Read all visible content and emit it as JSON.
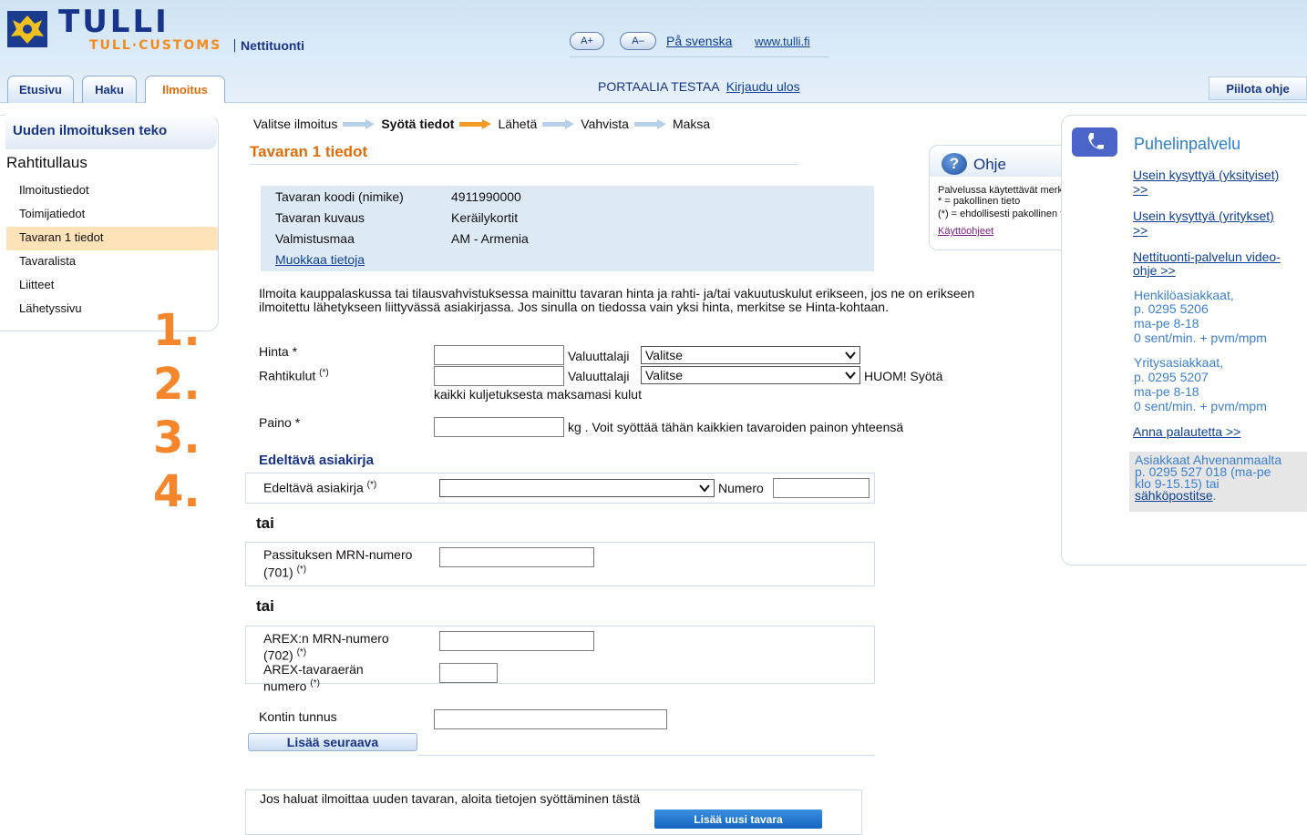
{
  "header": {
    "logo": "TULLI",
    "logo_sub": "TULL·CUSTOMS",
    "service_name": "Nettituonti",
    "font_bigger": "A+",
    "font_smaller": "A–",
    "lang_swedish": "På svenska",
    "site_link": "www.tulli.fi",
    "user_status": "PORTAALIA TESTAA",
    "logout": "Kirjaudu ulos",
    "hide_help": "Piilota ohje"
  },
  "tabs": [
    {
      "label": "Etusivu",
      "active": false
    },
    {
      "label": "Haku",
      "active": false
    },
    {
      "label": "Ilmoitus",
      "active": true
    }
  ],
  "sidebar": {
    "title": "Uuden ilmoituksen teko",
    "section": "Rahtitullaus",
    "items": [
      {
        "label": "Ilmoitustiedot",
        "active": false
      },
      {
        "label": "Toimijatiedot",
        "active": false
      },
      {
        "label": "Tavaran 1 tiedot",
        "active": true
      },
      {
        "label": "Tavaralista",
        "active": false
      },
      {
        "label": "Liitteet",
        "active": false
      },
      {
        "label": "Lähetyssivu",
        "active": false
      }
    ]
  },
  "annotations": [
    "1.",
    "2.",
    "3.",
    "4."
  ],
  "steps": [
    "Valitse ilmoitus",
    "Syötä tiedot",
    "Lähetä",
    "Vahvista",
    "Maksa"
  ],
  "page_title": "Tavaran 1 tiedot",
  "goods_info": [
    {
      "label": "Tavaran koodi (nimike)",
      "value": "4911990000"
    },
    {
      "label": "Tavaran kuvaus",
      "value": "Keräilykortit"
    },
    {
      "label": "Valmistusmaa",
      "value": "AM - Armenia"
    }
  ],
  "edit_link": "Muokkaa tietoja",
  "price_instructions": "Ilmoita kauppalaskussa tai tilausvahvistuksessa mainittu tavaran hinta ja rahti- ja/tai vakuutuskulut erikseen, jos ne on erikseen ilmoitettu lähetykseen liittyvässä asiakirjassa.  Jos sinulla on tiedossa vain yksi hinta, merkitse se Hinta-kohtaan.",
  "form": {
    "price_label": "Hinta *",
    "freight_label": "Rahtikulut",
    "conditional_mark": "(*)",
    "currency_label": "Valuuttalaji",
    "currency_placeholder": "Valitse",
    "freight_note": "HUOM! Syötä",
    "freight_note_2": "kaikki kuljetuksesta maksamasi kulut",
    "weight_label": "Paino *",
    "weight_note": "kg . Voit syöttää tähän kaikkien tavaroiden painon yhteensä",
    "prev_doc_heading": "Edeltävä asiakirja",
    "prev_doc_label": "Edeltävä asiakirja",
    "number_label": "Numero",
    "or": "tai",
    "transit_mrn_label": "Passituksen MRN-numero",
    "transit_mrn_label_2": "(701)",
    "arex_mrn_label": "AREX:n MRN-numero",
    "arex_mrn_label_2": "(702)",
    "arex_item_label": "AREX-tavaraerän",
    "arex_item_label_2": "numero",
    "container_label": "Kontin tunnus",
    "add_next": "Lisää seuraava"
  },
  "new_goods": {
    "text": "Jos haluat ilmoittaa uuden tavaran, aloita tietojen syöttäminen tästä",
    "button": "Lisää uusi tavara"
  },
  "help": {
    "title": "Ohje",
    "line1": "Palvelussa käytettävät merkinnät:",
    "line2": "* = pakollinen tieto",
    "line3": "(*) = ehdollisesti pakollinen tieto",
    "manual_link": "Käyttöohjeet"
  },
  "right_panel": {
    "title": "Puhelinpalvelu",
    "faq_private": "Usein kysyttyä (yksityiset)",
    "faq_business": "Usein kysyttyä (yritykset)",
    "more": ">>",
    "video_1": "Nettituonti-palvelun video-",
    "video_2": "ohje >>",
    "private_1": "Henkilöasiakkaat,",
    "private_2": "p. 0295 5206",
    "private_3": "ma-pe 8-18",
    "private_4": "0 sent/min. + pvm/mpm",
    "business_1": "Yritysasiakkaat,",
    "business_2": "p. 0295 5207",
    "business_3": "ma-pe 8-18",
    "business_4": "0 sent/min. + pvm/mpm",
    "feedback": "Anna palautetta >>",
    "aland_1": "Asiakkaat Ahvenanmaalta",
    "aland_2": "p. 0295 527 018 (ma-pe",
    "aland_3": "klo 9-15.15) tai",
    "aland_link": "sähköpostitse",
    "aland_end": "."
  },
  "colors": {
    "brand_blue": "#17348a",
    "accent_orange": "#e06d0a",
    "annotation_orange": "#f5862b",
    "link_blue": "#0d3f9a",
    "info_bg": "#dde9f5",
    "active_item_bg": "#fde3b7"
  }
}
